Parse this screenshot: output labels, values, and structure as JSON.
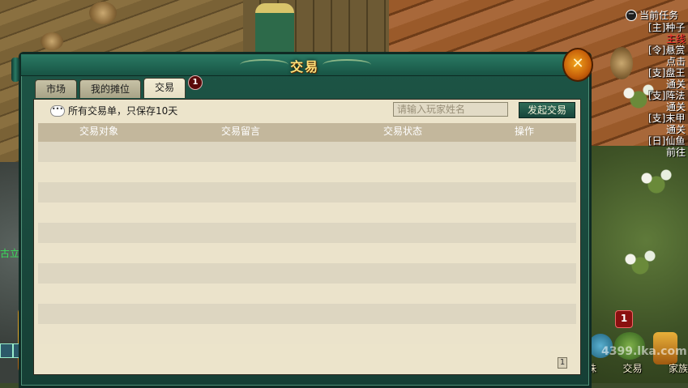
{
  "window": {
    "title": "交易",
    "close_icon": "close-x-icon",
    "tabs": [
      {
        "label": "市场",
        "active": false
      },
      {
        "label": "我的摊位",
        "active": false
      },
      {
        "label": "交易",
        "active": true
      }
    ],
    "tab_badge": "1",
    "notice": "所有交易单，只保存10天",
    "search": {
      "placeholder": "请输入玩家姓名",
      "value": ""
    },
    "start_trade_button": "发起交易",
    "table": {
      "columns": [
        "交易对象",
        "交易留言",
        "交易状态",
        "操作"
      ],
      "rows": []
    },
    "pager": {
      "page": "1"
    }
  },
  "quest_tracker": {
    "title": "当前任务",
    "items": [
      {
        "tag": "[主]种子",
        "sub": "主线",
        "sub_color": "#ff3030"
      },
      {
        "tag": "[令]悬赏",
        "sub": "点击"
      },
      {
        "tag": "[支]盘王",
        "sub": "通关"
      },
      {
        "tag": "[支]阵法",
        "sub": "通关"
      },
      {
        "tag": "[支]末甲",
        "sub": "通关"
      },
      {
        "tag": "[日]仙鱼",
        "sub": "前往"
      }
    ]
  },
  "left_hint_text": "古立即购",
  "dock": {
    "badge": "1",
    "labels": [
      "珠",
      "交易",
      "家族"
    ],
    "watermark": "4399.lka.com"
  }
}
